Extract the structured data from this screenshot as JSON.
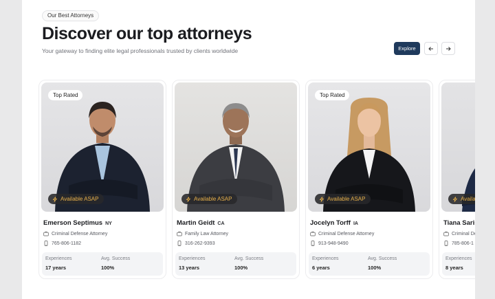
{
  "header": {
    "pill": "Our Best Attorneys",
    "title": "Discover our top attorneys",
    "subtitle": "Your gateway to finding elite legal professionals trusted by clients worldwide",
    "explore_label": "Explore"
  },
  "labels": {
    "top_rated": "Top Rated",
    "available": "Available ASAP",
    "experiences": "Experiences",
    "avg_success": "Avg. Success"
  },
  "attorneys": [
    {
      "name": "Emerson Septimus",
      "state": "NY",
      "role": "Criminal Defense Attorney",
      "phone": "765-806-1182",
      "experience": "17 years",
      "success": "100%",
      "top_rated": true
    },
    {
      "name": "Martin Geidt",
      "state": "CA",
      "role": "Family Law Attorney",
      "phone": "316-262-9393",
      "experience": "13 years",
      "success": "100%",
      "top_rated": false
    },
    {
      "name": "Jocelyn Torff",
      "state": "IA",
      "role": "Criminal Defense Attorney",
      "phone": "913-948-9490",
      "experience": "6 years",
      "success": "100%",
      "top_rated": true
    },
    {
      "name": "Tiana Saris",
      "state": "",
      "role": "Criminal De",
      "phone": "785-806-1",
      "experience": "8 years",
      "success": "",
      "top_rated": false
    }
  ],
  "icons": {
    "explore": "none",
    "prev": "arrow-left-icon",
    "next": "arrow-right-icon",
    "available": "lightning-icon",
    "role": "briefcase-icon",
    "phone": "phone-icon"
  },
  "colors": {
    "accent": "#1f3a5c",
    "available_text": "#e7b04a"
  }
}
